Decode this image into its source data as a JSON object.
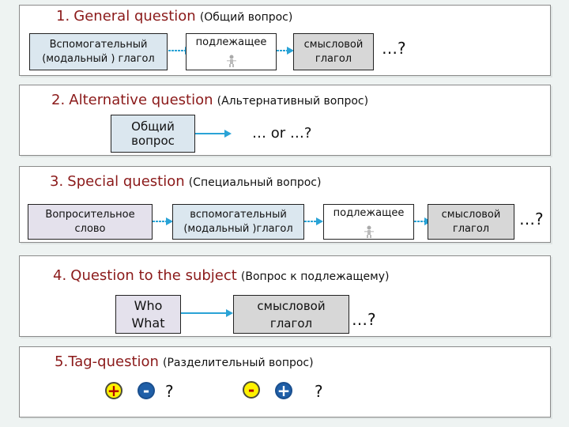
{
  "sections": [
    {
      "number": "1.",
      "title_en": "General question",
      "title_ru": "(Общий вопрос)",
      "boxes": [
        {
          "lines": [
            "Вспомогательный",
            "(модальный ) глагол"
          ],
          "fill": "blue"
        },
        {
          "lines": [
            "подлежащее"
          ],
          "fill": "white",
          "icon": "person-icon"
        },
        {
          "lines": [
            "смысловой",
            "глагол"
          ],
          "fill": "gray"
        }
      ],
      "tail": "…?"
    },
    {
      "number": "2.",
      "title_en": "Alternative  question",
      "title_ru": "(Альтернативный вопрос)",
      "boxes": [
        {
          "lines": [
            "Общий",
            "вопрос"
          ],
          "fill": "blue"
        }
      ],
      "tail": "… or …?"
    },
    {
      "number": "3.",
      "title_en": "Special question",
      "title_ru": "(Специальный вопрос)",
      "boxes": [
        {
          "lines": [
            "Вопросительное",
            "слово"
          ],
          "fill": "lavender"
        },
        {
          "lines": [
            "вспомогательный",
            "(модальный )глагол"
          ],
          "fill": "blue"
        },
        {
          "lines": [
            "подлежащее"
          ],
          "fill": "white",
          "icon": "person-icon"
        },
        {
          "lines": [
            "смысловой",
            "глагол"
          ],
          "fill": "gray"
        }
      ],
      "tail": "…?"
    },
    {
      "number": "4.",
      "title_en": "Question to the subject",
      "title_ru": "(Вопрос к подлежащему)",
      "boxes": [
        {
          "lines": [
            "Who",
            "What"
          ],
          "fill": "lavender"
        },
        {
          "lines": [
            "смысловой",
            "глагол"
          ],
          "fill": "gray"
        }
      ],
      "tail": "…?"
    },
    {
      "number": "5.",
      "title_en": "Tag-question",
      "title_ru": "(Разделительный вопрос)",
      "patterns": [
        {
          "first": "+",
          "second": "-",
          "end": "?"
        },
        {
          "first": "-",
          "second": "+",
          "end": "?"
        }
      ]
    }
  ],
  "colors": {
    "title_en": "#8b1a1a",
    "arrow": "#2aa3d6",
    "box_blue": "#dbe7ef",
    "box_lavender": "#e4e1ec",
    "box_gray": "#d7d7d7",
    "sign_yellow": "#fff200",
    "sign_blue": "#1f5fa8"
  }
}
